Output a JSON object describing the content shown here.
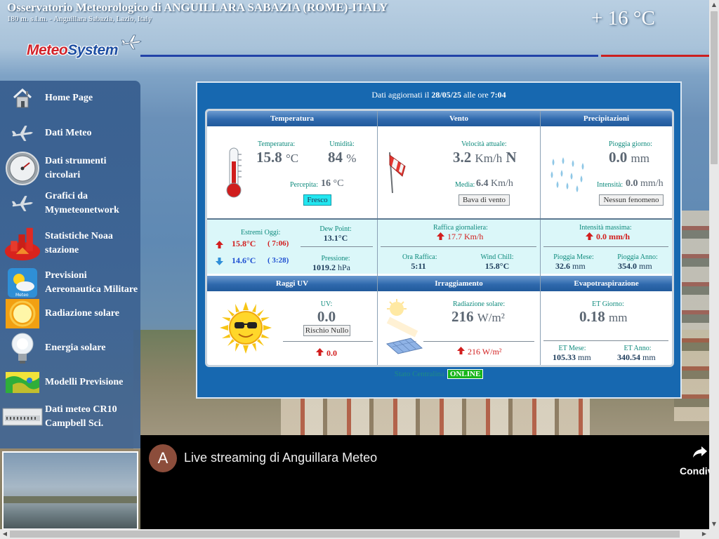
{
  "header": {
    "title": "Osservatorio Meteorologico di ANGUILLARA SABAZIA (ROME)-ITALY",
    "subtitle": "180 m. s.l.m. - Anguillara Sabazia, Lazio, Italy",
    "current_temp": "+ 16 °C",
    "logo_part1": "Meteo",
    "logo_part2": "System"
  },
  "sidebar": {
    "items": [
      {
        "label": "Home Page",
        "icon": "house-icon"
      },
      {
        "label": "Dati Meteo",
        "icon": "plane-icon"
      },
      {
        "label": "Dati strumenti circolari",
        "icon": "gauge-icon"
      },
      {
        "label": "Grafici da Mymeteonetwork",
        "icon": "plane-icon"
      },
      {
        "label": "Statistiche Noaa stazione",
        "icon": "bar-chart-icon"
      },
      {
        "label": "Previsioni Aereonautica Militare",
        "icon": "sun-cloud-icon"
      },
      {
        "label": "Radiazione solare",
        "icon": "sun-icon"
      },
      {
        "label": "Energia solare",
        "icon": "lightbulb-icon"
      },
      {
        "label": "Modelli Previsione",
        "icon": "forecast-map-icon"
      },
      {
        "label": "Dati meteo CR10 Campbell Sci.",
        "icon": "datalogger-icon"
      }
    ]
  },
  "panel": {
    "updated_prefix": "Dati aggiornati il ",
    "updated_date": "28/05/25",
    "updated_mid": " alle ore ",
    "updated_time": "7:04",
    "sections": {
      "temperatura": "Temperatura",
      "vento": "Vento",
      "precipitazioni": "Precipitazioni",
      "raggi_uv": "Raggi UV",
      "irraggiamento": "Irraggiamento",
      "evapotraspirazione": "Evapotraspirazione"
    },
    "temperatura": {
      "temp_label": "Temperatura:",
      "temp_value": "15.8",
      "temp_unit": "°C",
      "hum_label": "Umidità:",
      "hum_value": "84",
      "hum_unit": "%",
      "perc_label": "Percepita:",
      "perc_value": "16",
      "perc_unit": "°C",
      "badge": "Fresco",
      "extremes_label": "Estremi Oggi:",
      "max_value": "15.8°C",
      "max_time": "( 7:06)",
      "min_value": "14.6°C",
      "min_time": "( 3:28)",
      "dew_label": "Dew Point:",
      "dew_value": "13.1°C",
      "press_label": "Pressione:",
      "press_value": "1019.2",
      "press_unit": "hPa"
    },
    "vento": {
      "speed_label": "Velocità attuale:",
      "speed_value": "3.2",
      "speed_unit": "Km/h",
      "direction": "N",
      "avg_label": "Media:",
      "avg_value": "6.4",
      "avg_unit": "Km/h",
      "badge": "Bava di vento",
      "gust_label": "Raffica giornaliera:",
      "gust_value": "17.7 Km/h",
      "gust_time_label": "Ora Raffica:",
      "gust_time": "5:11",
      "chill_label": "Wind Chill:",
      "chill_value": "15.8°C"
    },
    "precipitazioni": {
      "day_label": "Pioggia giorno:",
      "day_value": "0.0",
      "day_unit": "mm",
      "int_label": "Intensità:",
      "int_value": "0.0",
      "int_unit": "mm/h",
      "badge": "Nessun fenomeno",
      "max_int_label": "Intensità massima:",
      "max_int_value": "0.0 mm/h",
      "month_label": "Pioggia Mese:",
      "month_value": "32.6",
      "month_unit": "mm",
      "year_label": "Pioggia Anno:",
      "year_value": "354.0",
      "year_unit": "mm"
    },
    "uv": {
      "label": "UV:",
      "value": "0.0",
      "badge": "Rischio Nullo",
      "max_value": "0.0"
    },
    "irraggiamento": {
      "label": "Radiazione solare:",
      "value": "216",
      "unit": "W/m²",
      "max_value": "216 W/m²"
    },
    "et": {
      "day_label": "ET Giorno:",
      "day_value": "0.18",
      "day_unit": "mm",
      "month_label": "ET Mese:",
      "month_value": "105.33",
      "month_unit": "mm",
      "year_label": "ET Anno:",
      "year_value": "340.54",
      "year_unit": "mm"
    },
    "status_label": "Stato Centralina",
    "status_value": "ONLINE"
  },
  "video": {
    "avatar_letter": "A",
    "title": "Live streaming di Anguillara Meteo",
    "share_label": "Condivi"
  },
  "colors": {
    "panel_bg": "#1768b0",
    "header_blue": "#2f69ad",
    "value_teal": "#0d8a7c",
    "arrow_red": "#d21e1e",
    "arrow_blue": "#1e4fd1",
    "online_green": "#17b51b"
  }
}
